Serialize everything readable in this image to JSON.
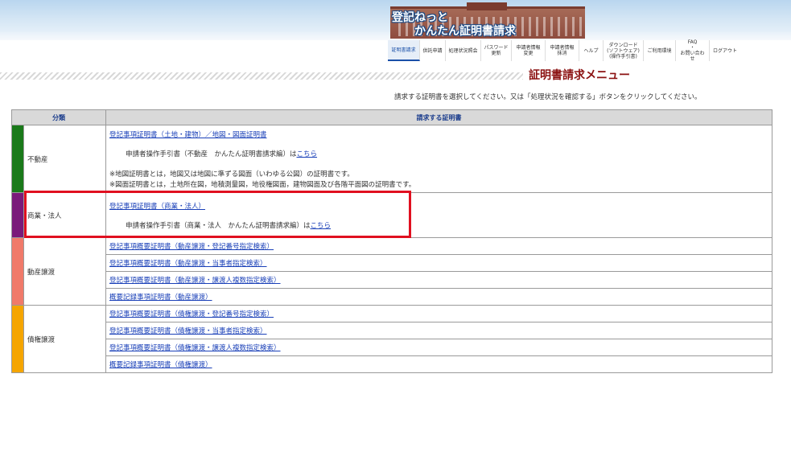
{
  "header": {
    "logo_line1": "登記ねっと",
    "logo_line2": "かんたん証明書請求"
  },
  "nav": [
    {
      "label": "証明書請求",
      "active": true
    },
    {
      "label": "供託申請"
    },
    {
      "label": "処理状況照会"
    },
    {
      "label": "パスワード\n更新"
    },
    {
      "label": "申請者情報\n変更"
    },
    {
      "label": "申請者情報\n抹消"
    },
    {
      "label": "ヘルプ"
    },
    {
      "label": "ダウンロード\n(ソフトウェア)\n(操作手引書)"
    },
    {
      "label": "ご利用環境"
    },
    {
      "label": "FAQ\n・\nお問い合わせ"
    },
    {
      "label": "ログアウト"
    }
  ],
  "page_title": "証明書請求メニュー",
  "instruction": "請求する証明書を選択してください。又は「処理状況を確認する」ボタンをクリックしてください。",
  "table": {
    "col_category": "分類",
    "col_certificate": "請求する証明書",
    "groups": [
      {
        "category": "不動産",
        "color": "#1a7a1a",
        "link": "登記事項証明書（土地・建物）／地図・図面証明書",
        "manual_text": "申請者操作手引書（不動産　かんたん証明書請求編）は",
        "manual_link": "こちら",
        "notes": [
          "※地図証明書とは，地図又は地図に準ずる図面（いわゆる公図）の証明書です。",
          "※図面証明書とは，土地所在図，地積測量図，地役権図面，建物図面及び各階平面図の証明書です。"
        ]
      },
      {
        "category": "商業・法人",
        "color": "#7a1a7a",
        "link": "登記事項証明書（商業・法人）",
        "manual_text": "申請者操作手引書（商業・法人　かんたん証明書請求編）は",
        "manual_link": "こちら"
      },
      {
        "category": "動産譲渡",
        "color": "#f07a6a",
        "items": [
          "登記事項概要証明書（動産譲渡・登記番号指定検索）",
          "登記事項概要証明書（動産譲渡・当事者指定検索）",
          "登記事項概要証明書（動産譲渡・譲渡人複数指定検索）",
          "概要記録事項証明書（動産譲渡）"
        ]
      },
      {
        "category": "債権譲渡",
        "color": "#f5a500",
        "items": [
          "登記事項概要証明書（債権譲渡・登記番号指定検索）",
          "登記事項概要証明書（債権譲渡・当事者指定検索）",
          "登記事項概要証明書（債権譲渡・譲渡人複数指定検索）",
          "概要記録事項証明書（債権譲渡）"
        ]
      }
    ]
  },
  "highlight_color": "#e01020"
}
